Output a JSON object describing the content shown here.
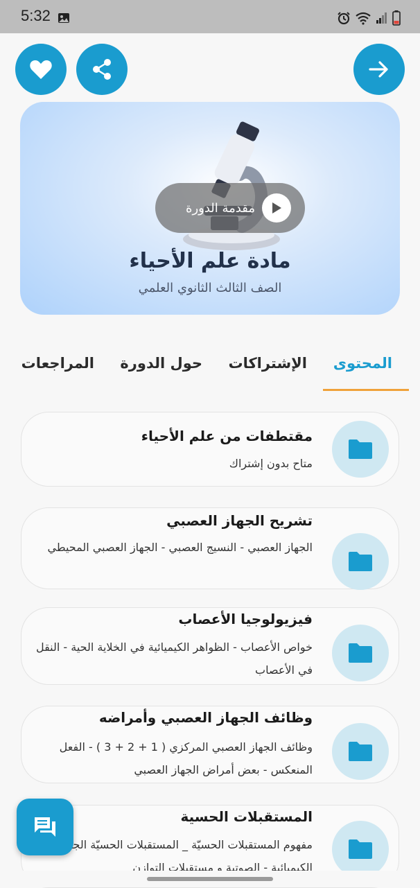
{
  "status_bar": {
    "time": "5:32"
  },
  "actions": {
    "favorite_icon": "heart-icon",
    "share_icon": "share-icon",
    "back_icon": "arrow-right-icon"
  },
  "hero": {
    "intro_label": "مقدمة الدورة",
    "title": "مادة علم الأحياء",
    "subtitle": "الصف الثالث الثانوي العلمي"
  },
  "tabs": [
    {
      "label": "المحتوى",
      "active": true
    },
    {
      "label": "الإشتراكات",
      "active": false
    },
    {
      "label": "حول الدورة",
      "active": false
    },
    {
      "label": "المراجعات",
      "active": false
    }
  ],
  "units": [
    {
      "title": "مقتطفات من علم الأحياء",
      "description": "متاح بدون إشتراك"
    },
    {
      "title": "تشريح الجهاز العصبي",
      "description": "الجهاز العصبي - النسيج العصبي - الجهاز العصبي المحيطي"
    },
    {
      "title": "فيزيولوجيا الأعصاب",
      "description": "خواص الأعصاب - الظواهر الكيميائية في الخلاية الحية - النقل في الأعصاب"
    },
    {
      "title": "وظائف الجهاز العصبي وأمراضه",
      "description": "وظائف الجهاز العصبي المركزي ( 1 + 2 + 3 ) - الفعل المنعكس - بعض أمراض الجهاز العصبي"
    },
    {
      "title": "المستقبلات الحسية",
      "description": "مفهوم المستقبلات الحسيّة _ المستقبلات الحسيّة الجلد - الكيميائية - الصوتية و مستقبلات التوازن"
    }
  ],
  "colors": {
    "accent": "#1a9ccf",
    "tab_underline": "#f0a23a",
    "icon_bg": "#cfe8f2"
  }
}
